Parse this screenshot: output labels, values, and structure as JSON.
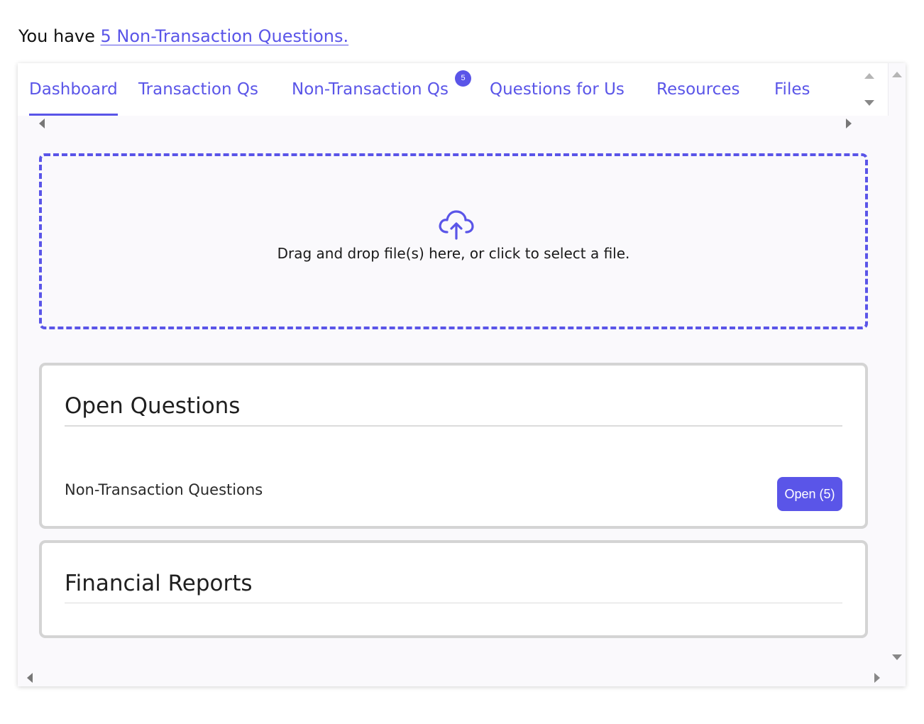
{
  "notice": {
    "prefix": "You have ",
    "link_text": "5 Non-Transaction Questions."
  },
  "tabs": [
    {
      "label": "Dashboard",
      "active": true
    },
    {
      "label": "Transaction Qs",
      "active": false
    },
    {
      "label": "Non-Transaction Qs",
      "active": false,
      "badge": "5"
    },
    {
      "label": "Questions for Us",
      "active": false
    },
    {
      "label": "Resources",
      "active": false
    },
    {
      "label": "Files",
      "active": false
    }
  ],
  "dropzone": {
    "icon": "cloud-upload-icon",
    "text": "Drag and drop file(s) here, or click to select a file."
  },
  "open_questions": {
    "title": "Open Questions",
    "row_label": "Non-Transaction Questions",
    "button_label": "Open (5)"
  },
  "financial_reports": {
    "title": "Financial Reports"
  },
  "colors": {
    "accent": "#5a55e8",
    "card_border": "#d4d4d4",
    "panel_bg": "#faf9fc"
  }
}
